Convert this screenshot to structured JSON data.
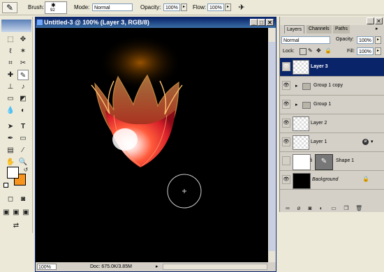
{
  "options_bar": {
    "brush_label": "Brush:",
    "brush_size": "92",
    "mode_label": "Mode:",
    "mode_value": "Normal",
    "opacity_label": "Opacity:",
    "opacity_value": "100%",
    "flow_label": "Flow:",
    "flow_value": "100%"
  },
  "document": {
    "title": "Untitled-3 @ 100% (Layer 3, RGB/8)",
    "zoom": "100%",
    "doc_info": "Doc: 675.0K/3.85M"
  },
  "layers_panel": {
    "tabs": [
      "Layers",
      "Channels",
      "Paths"
    ],
    "blend_mode": "Normal",
    "opacity_label": "Opacity:",
    "opacity_value": "100%",
    "lock_label": "Lock:",
    "fill_label": "Fill:",
    "fill_value": "100%",
    "layers": [
      {
        "name": "Layer 3",
        "selected": true,
        "type": "layer"
      },
      {
        "name": "Group 1 copy",
        "type": "group"
      },
      {
        "name": "Group 1",
        "type": "group"
      },
      {
        "name": "Layer 2",
        "type": "layer"
      },
      {
        "name": "Layer 1",
        "type": "layer"
      },
      {
        "name": "Shape 1",
        "type": "shape"
      },
      {
        "name": "Background",
        "type": "background"
      }
    ]
  },
  "colors": {
    "foreground": "#ffffff",
    "background": "#f7941d",
    "canvas": "#000000",
    "selection": "#0a246a"
  }
}
